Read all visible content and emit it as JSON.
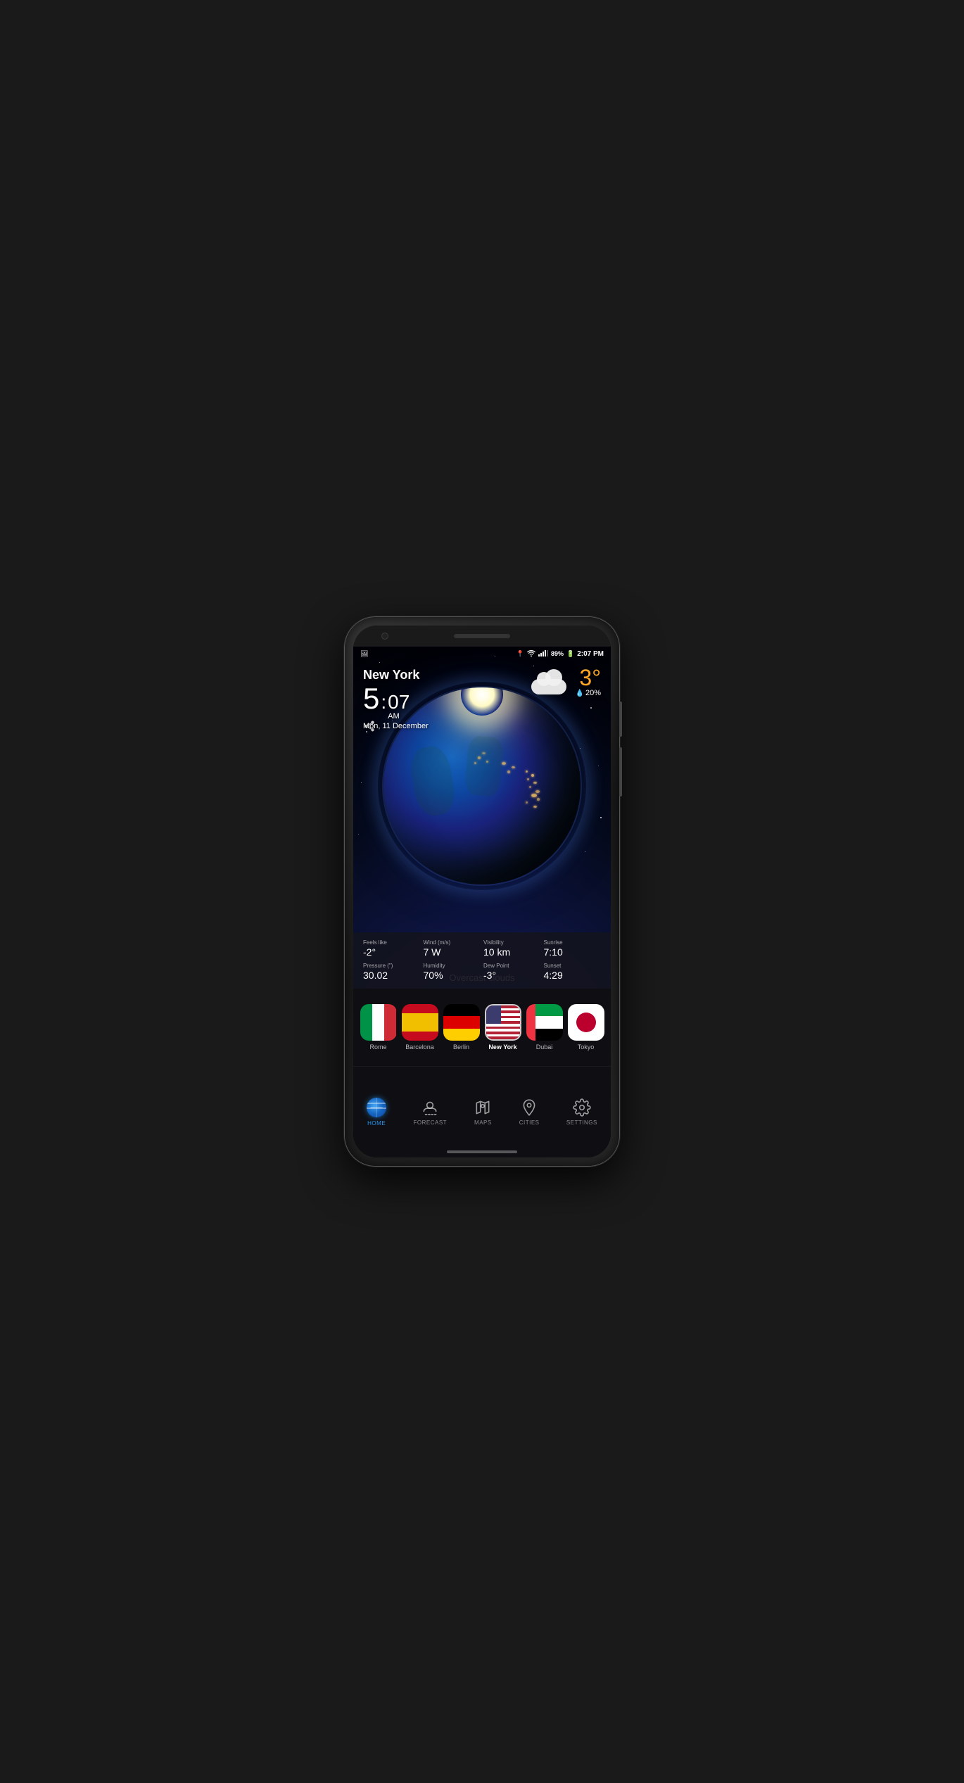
{
  "phone": {
    "status_bar": {
      "location_icon": "📍",
      "wifi_icon": "wifi",
      "signal_icon": "signal",
      "battery": "89%",
      "time": "2:07 PM"
    },
    "weather": {
      "city": "New York",
      "time_hour": "5",
      "time_minutes": "07",
      "time_ampm": "AM",
      "date": "Mon, 11 December",
      "temperature": "3°",
      "rain_chance": "20%",
      "condition": "Overcast clouds",
      "details": [
        {
          "label": "Feels like",
          "value": "-2°"
        },
        {
          "label": "Wind (m/s)",
          "value": "7 W"
        },
        {
          "label": "Visibility",
          "value": "10 km"
        },
        {
          "label": "Sunrise",
          "value": "7:10"
        },
        {
          "label": "Pressure (\")",
          "value": "30.02"
        },
        {
          "label": "Humidity",
          "value": "70%"
        },
        {
          "label": "Dew Point",
          "value": "-3°"
        },
        {
          "label": "Sunset",
          "value": "4:29"
        }
      ]
    },
    "cities": [
      {
        "name": "Rome",
        "flag": "italy",
        "active": false
      },
      {
        "name": "Barcelona",
        "flag": "spain",
        "active": false
      },
      {
        "name": "Berlin",
        "flag": "germany",
        "active": false
      },
      {
        "name": "New York",
        "flag": "usa",
        "active": true
      },
      {
        "name": "Dubai",
        "flag": "uae",
        "active": false
      },
      {
        "name": "Tokyo",
        "flag": "japan",
        "active": false
      }
    ],
    "nav": [
      {
        "id": "home",
        "label": "HOME",
        "active": true
      },
      {
        "id": "forecast",
        "label": "FORECAST",
        "active": false
      },
      {
        "id": "maps",
        "label": "MAPS",
        "active": false
      },
      {
        "id": "cities",
        "label": "CITIES",
        "active": false
      },
      {
        "id": "settings",
        "label": "SETTINGS",
        "active": false
      }
    ]
  }
}
